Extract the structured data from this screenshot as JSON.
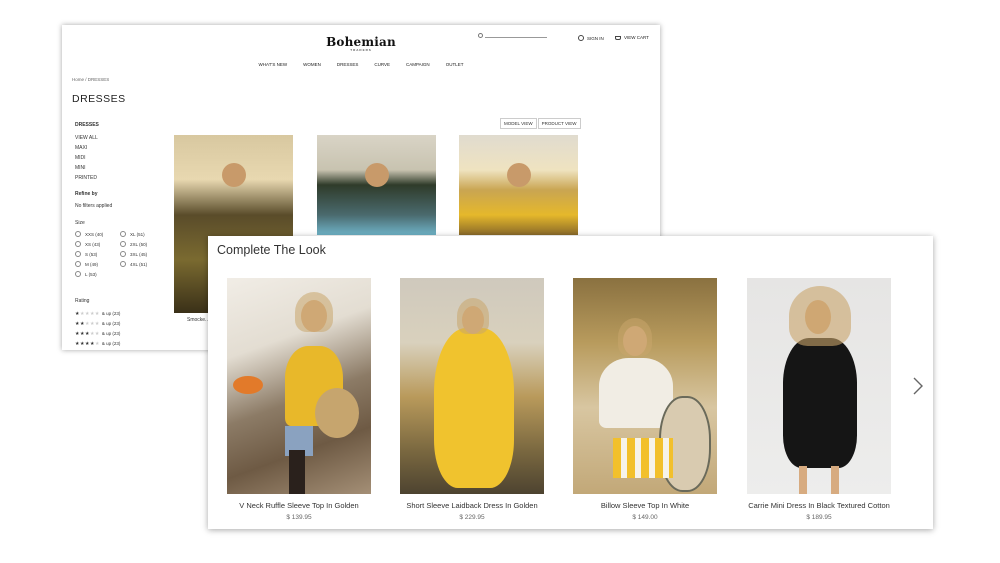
{
  "store": {
    "logo": "Bohemian",
    "logo_sub": "TRADERS",
    "account_label": "SIGN IN",
    "cart_label": "VIEW CART",
    "nav": [
      "WHAT'S NEW",
      "WOMEN",
      "DRESSES",
      "CURVE",
      "CAMPAIGN",
      "OUTLET"
    ],
    "breadcrumb": "Home  /  DRESSES",
    "page_title": "DRESSES",
    "sidebar": {
      "heading": "DRESSES",
      "items": [
        "VIEW ALL",
        "MAXI",
        "MIDI",
        "MINI",
        "PRINTED"
      ]
    },
    "refine": {
      "heading": "Refine by",
      "status": "No filters applied"
    },
    "size": {
      "heading": "Size",
      "options": [
        "XXS (40)",
        "XL (51)",
        "XS (43)",
        "2XL (50)",
        "S (53)",
        "3XL (45)",
        "M (49)",
        "4XL (51)",
        "L (53)"
      ]
    },
    "rating": {
      "heading": "Rating",
      "options": [
        {
          "filled": 1,
          "label": "& up (23)"
        },
        {
          "filled": 2,
          "label": "& up (23)"
        },
        {
          "filled": 3,
          "label": "& up (23)"
        },
        {
          "filled": 4,
          "label": "& up (23)"
        }
      ]
    },
    "view_toggle": {
      "model": "MODEL VIEW",
      "product": "PRODUCT VIEW"
    },
    "product_name_partial": "Smocke..."
  },
  "modal": {
    "title": "Complete The Look",
    "products": [
      {
        "name": "V Neck Ruffle Sleeve Top In Golden",
        "price": "$ 139.95"
      },
      {
        "name": "Short Sleeve Laidback Dress In Golden",
        "price": "$ 229.95"
      },
      {
        "name": "Billow Sleeve Top In White",
        "price": "$ 149.00"
      },
      {
        "name": "Carrie Mini Dress In Black Textured Cotton",
        "price": "$ 189.95"
      }
    ]
  },
  "icons": [
    "search-icon",
    "account-icon",
    "cart-icon",
    "chevron-right-icon"
  ]
}
